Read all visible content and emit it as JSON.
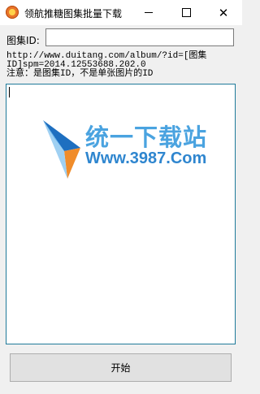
{
  "window": {
    "title": "领航推糖图集批量下载",
    "close_glyph": "✕"
  },
  "form": {
    "id_label": "图集ID:",
    "id_value": ""
  },
  "hint": {
    "line1": "http://www.duitang.com/album/?id=[图集",
    "line2": "ID]spm=2014.12553688.202.0",
    "line3": "注意：是图集ID，不是单张图片的ID"
  },
  "watermark": {
    "line1": "统一下载站",
    "line2": "Www.3987.Com"
  },
  "actions": {
    "start_label": "开始"
  },
  "icons": {
    "app": "app-logo-icon",
    "minimize": "minimize-icon",
    "maximize": "maximize-icon",
    "close": "close-icon"
  },
  "colors": {
    "log_border": "#1f7a9a",
    "watermark_blue": "#4aa3e0",
    "watermark_orange": "#f08c2a"
  }
}
